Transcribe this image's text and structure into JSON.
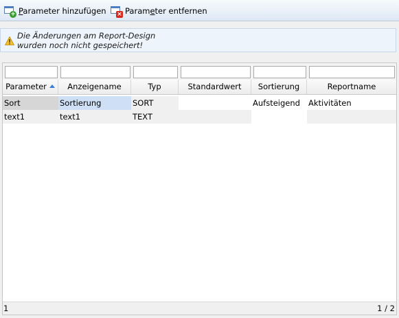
{
  "toolbar": {
    "add_label_accel": "P",
    "add_label_rest": "arameter hinzufügen",
    "remove_label_pre": "Param",
    "remove_label_accel": "e",
    "remove_label_rest": "ter entfernen"
  },
  "warning": {
    "line1": "Die Änderungen am Report-Design",
    "line2": "wurden noch nicht gespeichert!"
  },
  "grid": {
    "filters": [
      "",
      "",
      "",
      "",
      "",
      ""
    ],
    "columns": [
      "Parameter",
      "Anzeigename",
      "Typ",
      "Standardwert",
      "Sortierung",
      "Reportname"
    ],
    "sorted_column": "Parameter",
    "sort_direction": "ascending",
    "rows": [
      [
        "Sort",
        "Sortierung",
        "SORT",
        "",
        "Aufsteigend",
        "Aktivitäten"
      ],
      [
        "text1",
        "text1",
        "TEXT",
        "",
        "",
        ""
      ]
    ],
    "footer_left": "1",
    "footer_right": "1 / 2"
  },
  "colors": {
    "accent": "#3a7bd5",
    "selection": "#cfe0f6",
    "readonly_cell": "#f0f0f0",
    "warning_icon": "#f2c230"
  }
}
